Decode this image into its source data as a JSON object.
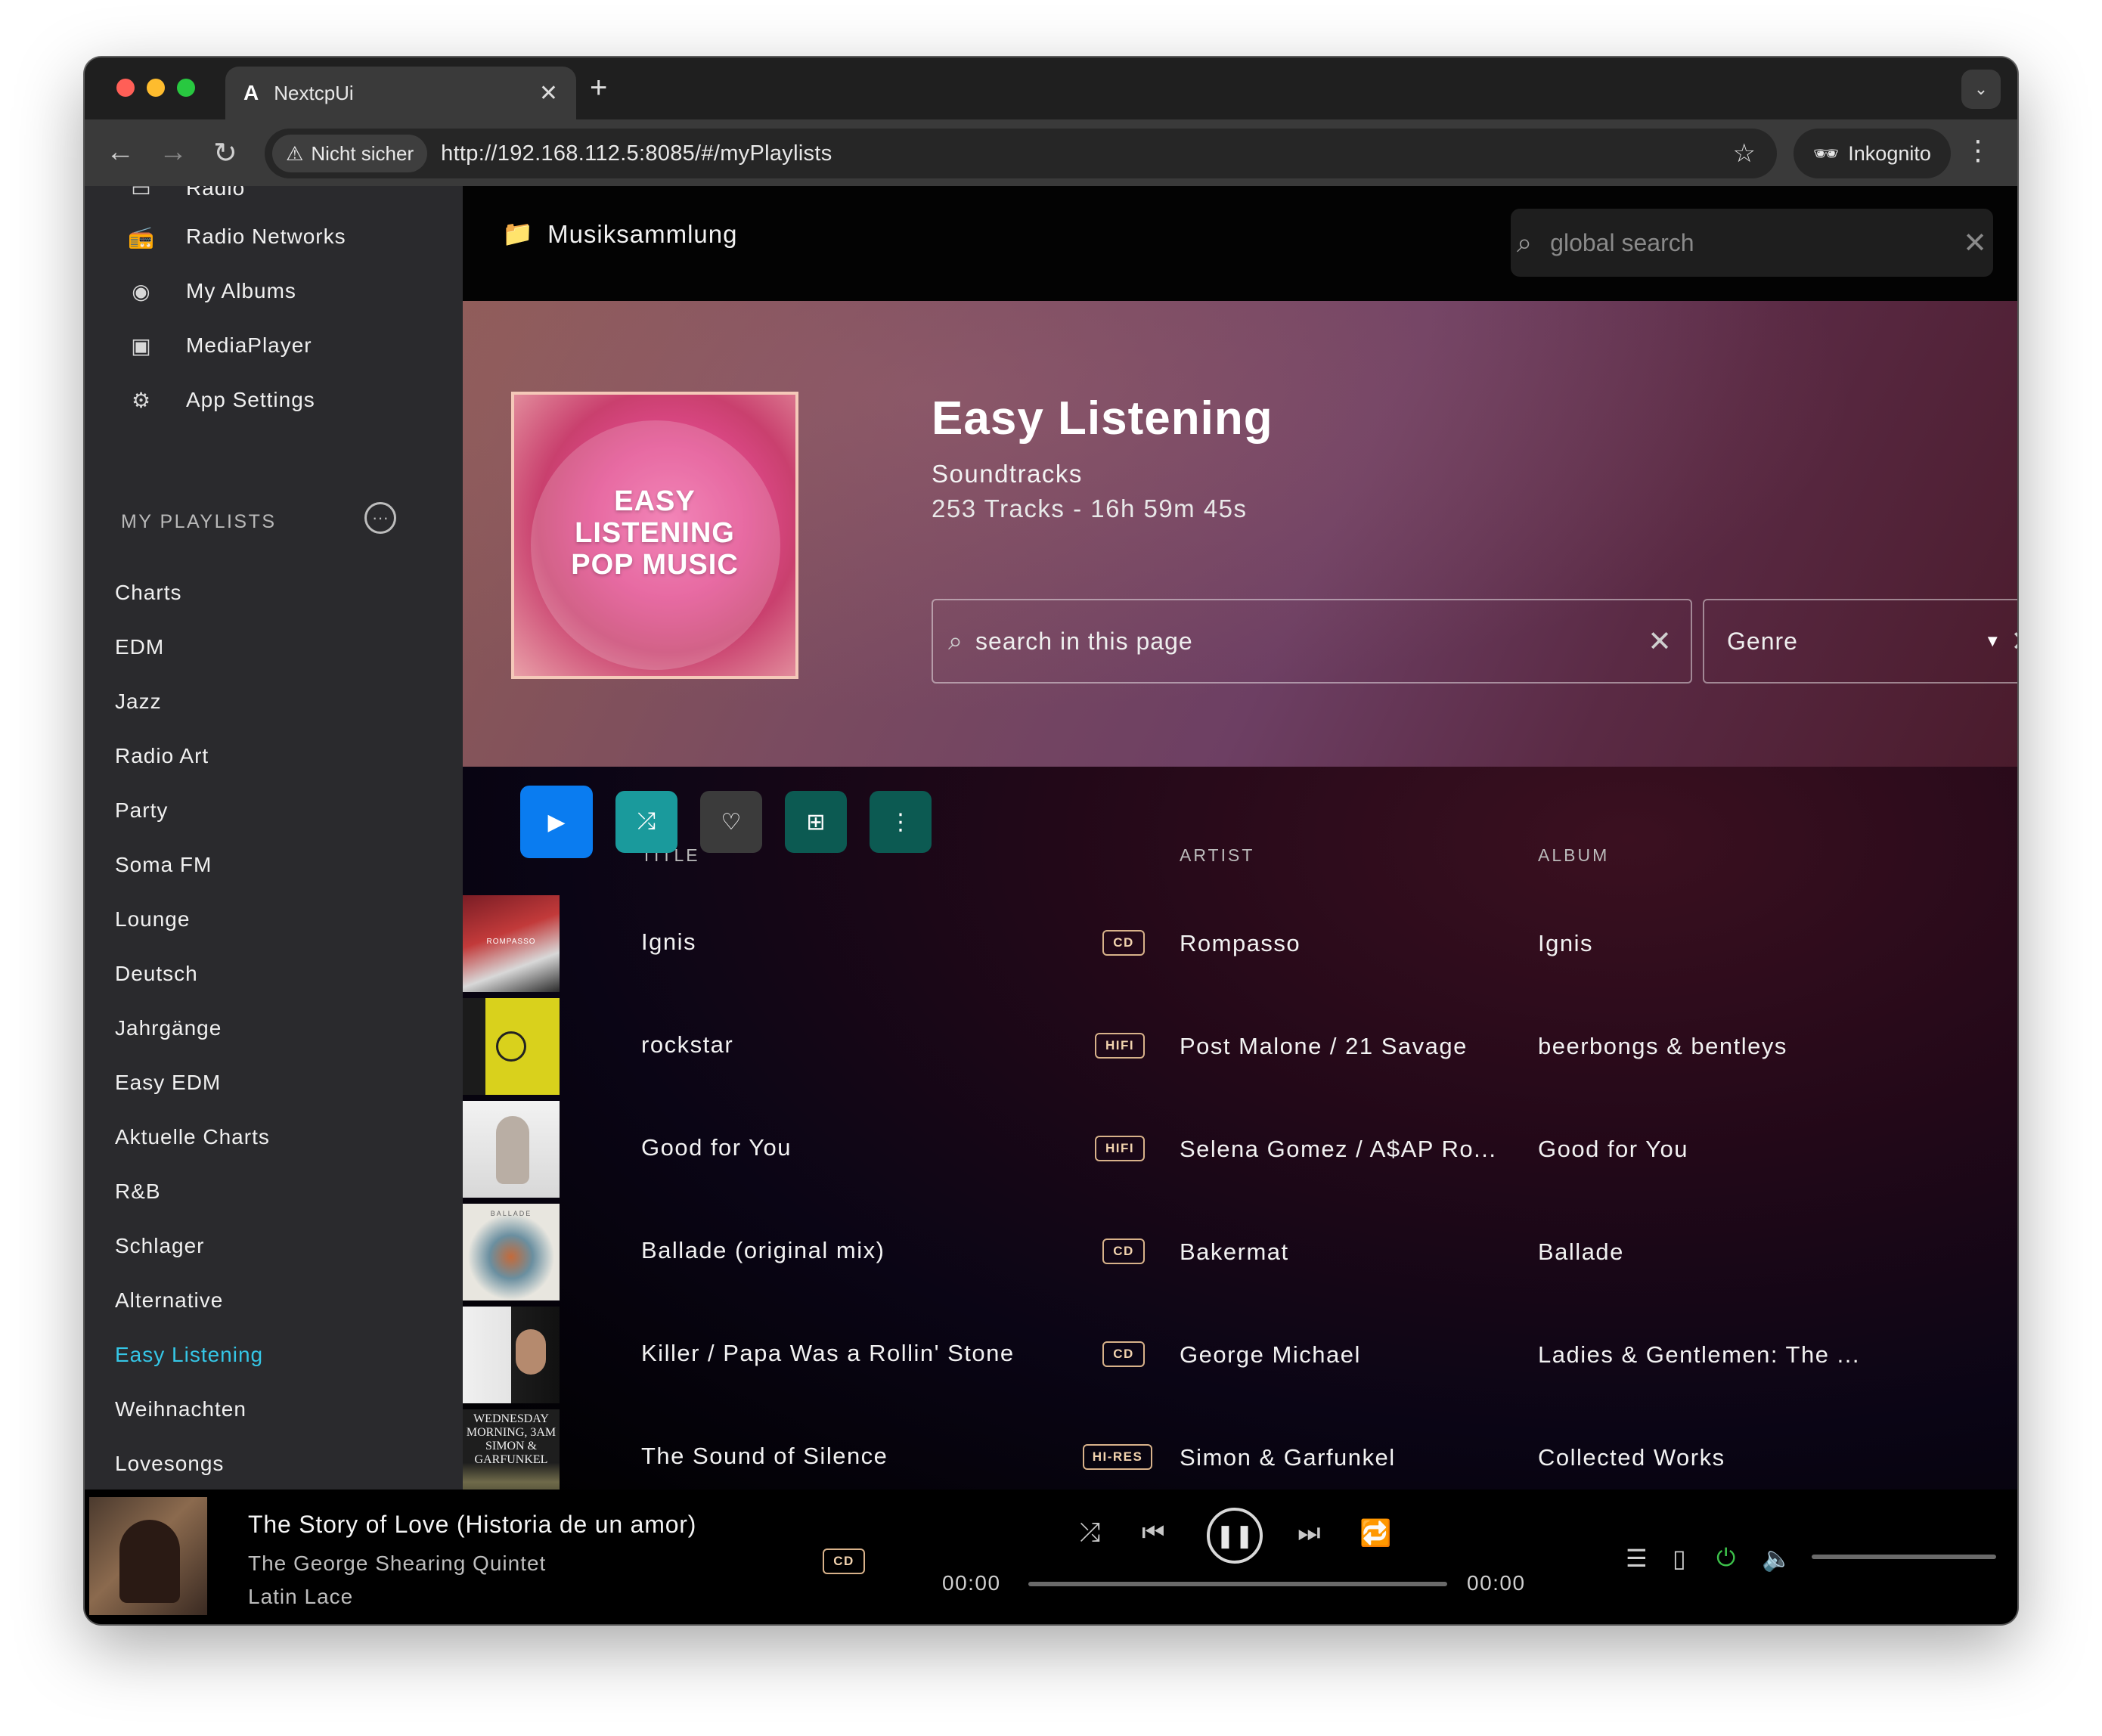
{
  "browser": {
    "tab_title": "NextcpUi",
    "tab_favicon": "A",
    "security_label": "Nicht sicher",
    "url": "http://192.168.112.5:8085/#/myPlaylists",
    "incognito_label": "Inkognito"
  },
  "sidebar": {
    "partial_item": "Radio",
    "nav": [
      {
        "label": "Radio Networks",
        "icon": "radio-icon"
      },
      {
        "label": "My Albums",
        "icon": "album-icon"
      },
      {
        "label": "MediaPlayer",
        "icon": "media-player-icon"
      },
      {
        "label": "App Settings",
        "icon": "gear-icon"
      }
    ],
    "playlists_header": "MY PLAYLISTS",
    "playlists": [
      "Charts",
      "EDM",
      "Jazz",
      "Radio Art",
      "Party",
      "Soma FM",
      "Lounge",
      "Deutsch",
      "Jahrgänge",
      "Easy EDM",
      "Aktuelle Charts",
      "R&B",
      "Schlager",
      "Alternative",
      "Easy Listening",
      "Weihnachten",
      "Lovesongs"
    ],
    "active_playlist": "Easy Listening",
    "active_color": "#35c6e6"
  },
  "topbar": {
    "collection_label": "Musiksammlung",
    "global_search_placeholder": "global search"
  },
  "playlist": {
    "title": "Easy Listening",
    "subtitle": "Soundtracks",
    "meta": "253 Tracks - 16h 59m 45s",
    "cover_text": [
      "EASY",
      "LISTENING",
      "POP MUSIC"
    ],
    "search_placeholder": "search in this page",
    "genre_placeholder": "Genre"
  },
  "actions": [
    {
      "name": "play",
      "icon": "play-icon",
      "color": "#0a7cf0"
    },
    {
      "name": "shuffle",
      "icon": "shuffle-icon",
      "color": "#1a9a9c"
    },
    {
      "name": "favorite",
      "icon": "heart-icon",
      "color": "#3b3b3b"
    },
    {
      "name": "add-to",
      "icon": "grid-plus-icon",
      "color": "#0c5a52"
    },
    {
      "name": "more",
      "icon": "more-vertical-icon",
      "color": "#0c5a52"
    }
  ],
  "columns": {
    "title": "TITLE",
    "artist": "ARTIST",
    "album": "ALBUM"
  },
  "tracks": [
    {
      "title": "Ignis",
      "quality": "CD",
      "artist": "Rompasso",
      "album": "Ignis"
    },
    {
      "title": "rockstar",
      "quality": "HIFI",
      "artist": "Post Malone / 21 Savage",
      "album": "beerbongs & bentleys"
    },
    {
      "title": "Good for You",
      "quality": "HIFI",
      "artist": "Selena Gomez / A$AP Ro...",
      "album": "Good for You"
    },
    {
      "title": "Ballade (original mix)",
      "quality": "CD",
      "artist": "Bakermat",
      "album": "Ballade"
    },
    {
      "title": "Killer / Papa Was a Rollin' Stone",
      "quality": "CD",
      "artist": "George Michael",
      "album": "Ladies & Gentlemen: The ..."
    },
    {
      "title": "The Sound of Silence",
      "quality": "HI-RES",
      "artist": "Simon & Garfunkel",
      "album": "Collected Works"
    }
  ],
  "thumb_texts": {
    "rompasso": "ROMPASSO",
    "bakermat": "BALLADE",
    "simon": [
      "WEDNESDAY",
      "MORNING, 3AM",
      "SIMON &",
      "GARFUNKEL"
    ]
  },
  "player": {
    "title": "The Story of Love (Historia de un amor)",
    "artist": "The George Shearing Quintet",
    "album": "Latin Lace",
    "quality": "CD",
    "time_elapsed": "00:00",
    "time_total": "00:00",
    "progress": 0,
    "power_color": "#3cc04a"
  }
}
